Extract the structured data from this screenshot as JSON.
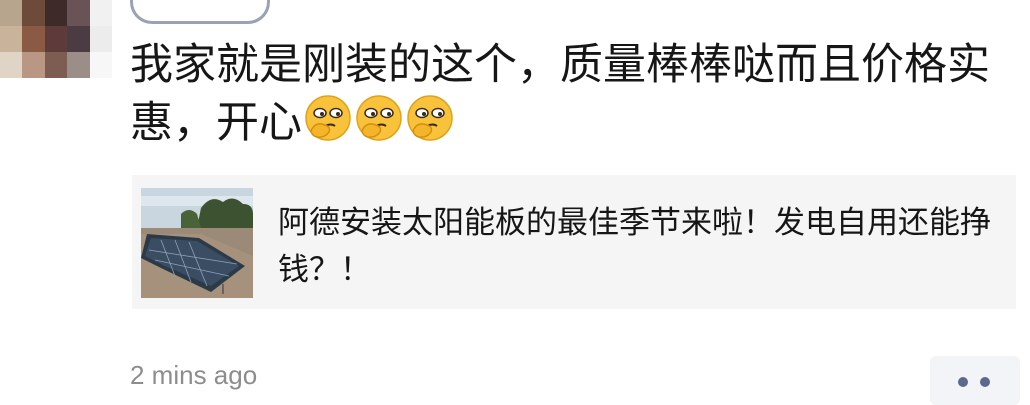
{
  "comment": {
    "text": "我家就是刚装的这个，质量棒棒哒而且价格实惠，开心",
    "emojis": [
      "thinking-face-icon",
      "thinking-face-icon",
      "thinking-face-icon"
    ]
  },
  "shared_article": {
    "title": "阿德安装太阳能板的最佳季节来啦！发电自用还能挣钱？！",
    "thumbnail": "solar-panels-on-roof"
  },
  "meta": {
    "time_ago": "2 mins ago",
    "more_icon": "more-dots-icon"
  },
  "colors": {
    "text_primary": "#161616",
    "text_secondary": "#8d8d8d",
    "card_bg": "#f5f5f5",
    "more_dots": "#5b6a8c"
  }
}
